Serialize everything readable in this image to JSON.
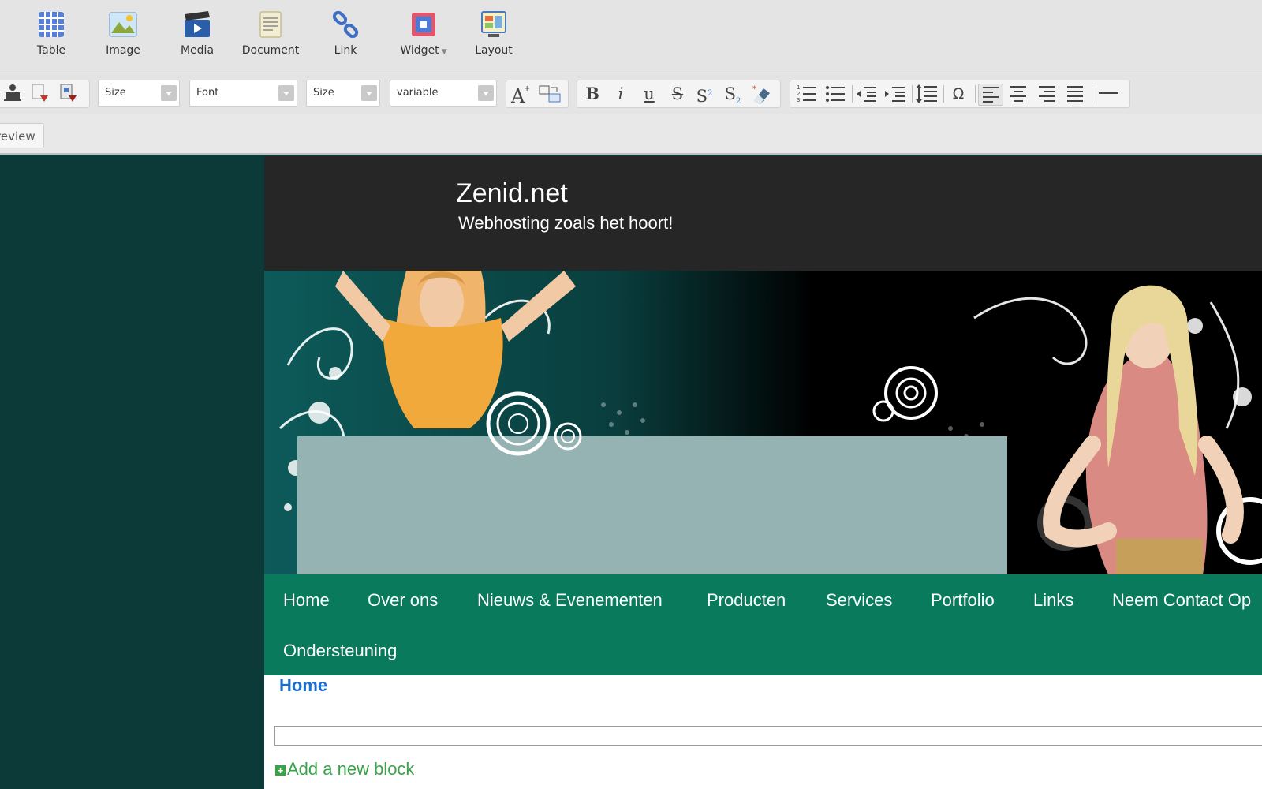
{
  "ribbon": {
    "items": [
      {
        "label": "Table",
        "icon": "table-icon"
      },
      {
        "label": "Image",
        "icon": "image-icon"
      },
      {
        "label": "Media",
        "icon": "media-icon"
      },
      {
        "label": "Document",
        "icon": "document-icon"
      },
      {
        "label": "Link",
        "icon": "link-icon"
      },
      {
        "label": "Widget",
        "icon": "widget-icon"
      },
      {
        "label": "Layout",
        "icon": "layout-icon"
      }
    ]
  },
  "format_toolbar": {
    "size_select_1": "Size",
    "font_select": "Font",
    "size_select_2": "Size",
    "line_height_select": "variable",
    "text_buttons": {
      "bold": "B",
      "italic": "i",
      "underline": "u",
      "strike": "S",
      "superscript": "S",
      "subscript": "S",
      "omega": "Ω"
    }
  },
  "tabs": {
    "preview": "review"
  },
  "site": {
    "title": "Zenid.net",
    "tagline": "Webhosting zoals het hoort!",
    "nav": [
      "Home",
      "Over ons",
      "Nieuws & Evenementen",
      "Producten",
      "Services",
      "Portfolio",
      "Links",
      "Neem Contact Op",
      "Ondersteuning"
    ],
    "breadcrumb": "Home",
    "add_block": "Add a new block"
  },
  "colors": {
    "left_pane": "#0b3a38",
    "site_header": "#262626",
    "nav_bar": "#0a7a5c",
    "banner_panel": "#96b3b3",
    "breadcrumb": "#1b6fd1",
    "add_block": "#3aa34a"
  }
}
